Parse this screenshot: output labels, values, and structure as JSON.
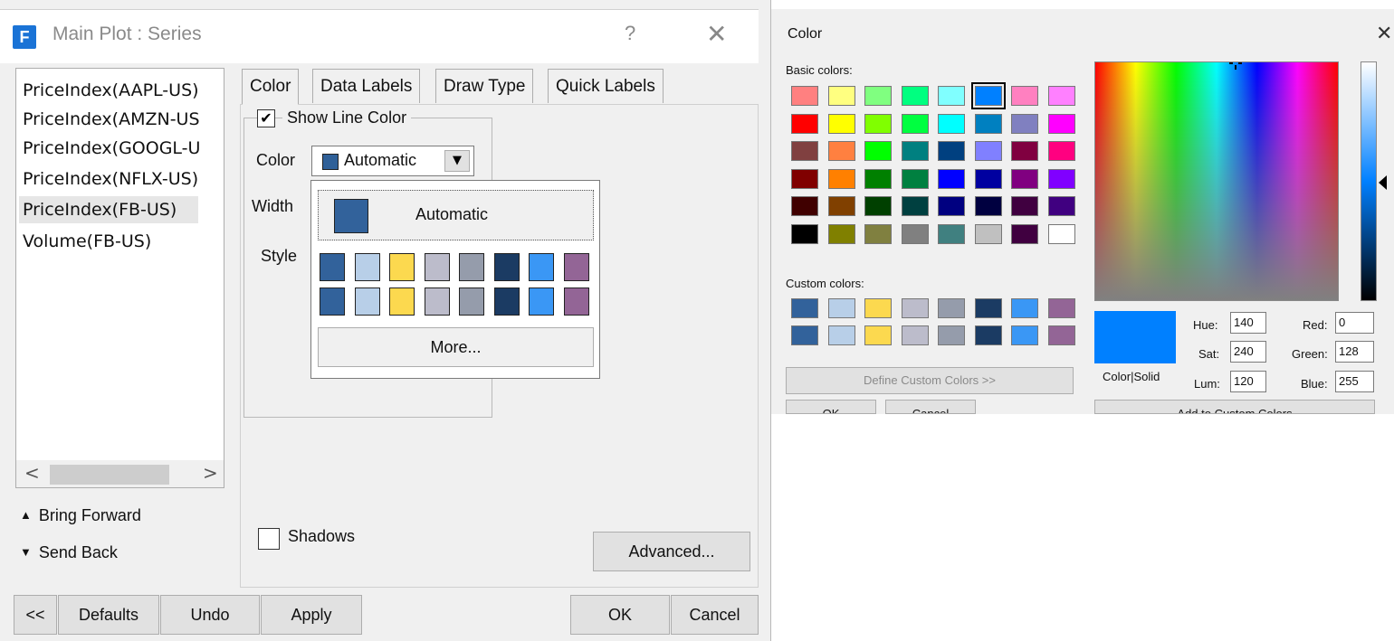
{
  "dialog": {
    "title": "Main Plot : Series",
    "logo_letter": "F",
    "help_glyph": "?",
    "close_glyph": "✕",
    "series": [
      "PriceIndex(AAPL-US)",
      "PriceIndex(AMZN-US",
      "PriceIndex(GOOGL-U",
      "PriceIndex(NFLX-US)",
      "PriceIndex(FB-US)",
      "Volume(FB-US)"
    ],
    "selected_series": "PriceIndex(FB-US)",
    "scroll_left": "<",
    "scroll_right": ">",
    "bring_forward": "Bring Forward",
    "send_back": "Send Back",
    "tabs": [
      "Color",
      "Data Labels",
      "Draw Type",
      "Quick Labels"
    ],
    "active_tab": "Color",
    "show_line_color_label": "Show Line Color",
    "show_line_color_checked": true,
    "check_glyph": "✔",
    "color_label": "Color",
    "width_label": "Width",
    "style_label": "Style",
    "color_value": "Automatic",
    "dropdown_arrow": "▼",
    "dropdown": {
      "automatic_label": "Automatic",
      "automatic_color": "#32629b",
      "palette_row1": [
        "#32629b",
        "#b8cfe8",
        "#fcd94f",
        "#bcbccb",
        "#959cab",
        "#1b3b63",
        "#3a97f5",
        "#936596"
      ],
      "palette_row2": [
        "#32629b",
        "#b8cfe8",
        "#fcd94f",
        "#bcbccb",
        "#959cab",
        "#1b3b63",
        "#3a97f5",
        "#936596"
      ],
      "more_label": "More..."
    },
    "shadows_label": "Shadows",
    "advanced_button": "Advanced...",
    "bottom_buttons": {
      "collapse": "<<",
      "defaults": "Defaults",
      "undo": "Undo",
      "apply": "Apply",
      "ok": "OK",
      "cancel": "Cancel"
    }
  },
  "picker": {
    "title": "Color",
    "close_glyph": "✕",
    "basic_colors_label": "Basic colors:",
    "basic_colors": [
      [
        "#ff8080",
        "#ffff80",
        "#80ff80",
        "#00ff80",
        "#80ffff",
        "#0080ff",
        "#ff80c0",
        "#ff80ff"
      ],
      [
        "#ff0000",
        "#ffff00",
        "#80ff00",
        "#00ff40",
        "#00ffff",
        "#0080c0",
        "#8080c0",
        "#ff00ff"
      ],
      [
        "#804040",
        "#ff8040",
        "#00ff00",
        "#008080",
        "#004080",
        "#8080ff",
        "#800040",
        "#ff0080"
      ],
      [
        "#800000",
        "#ff8000",
        "#008000",
        "#008040",
        "#0000ff",
        "#0000a0",
        "#800080",
        "#8000ff"
      ],
      [
        "#400000",
        "#804000",
        "#004000",
        "#004040",
        "#000080",
        "#000040",
        "#400040",
        "#400080"
      ],
      [
        "#000000",
        "#808000",
        "#808040",
        "#808080",
        "#408080",
        "#c0c0c0",
        "#400040",
        "#ffffff"
      ]
    ],
    "selected_basic": "#0080ff",
    "custom_colors_label": "Custom colors:",
    "custom_colors": [
      [
        "#32629b",
        "#b8cfe8",
        "#fcd94f",
        "#bcbccb",
        "#959cab",
        "#1b3b63",
        "#3a97f5",
        "#936596"
      ],
      [
        "#32629b",
        "#b8cfe8",
        "#fcd94f",
        "#bcbccb",
        "#959cab",
        "#1b3b63",
        "#3a97f5",
        "#936596"
      ]
    ],
    "define_custom": "Define Custom Colors >>",
    "color_solid_label": "Color|Solid",
    "preview_color": "#0080ff",
    "hue_label": "Hue:",
    "hue": "140",
    "sat_label": "Sat:",
    "sat": "240",
    "lum_label": "Lum:",
    "lum": "120",
    "red_label": "Red:",
    "red": "0",
    "green_label": "Green:",
    "green": "128",
    "blue_label": "Blue:",
    "blue": "255",
    "ok": "OK",
    "cancel": "Cancel",
    "add_custom": "Add to Custom Colors"
  }
}
